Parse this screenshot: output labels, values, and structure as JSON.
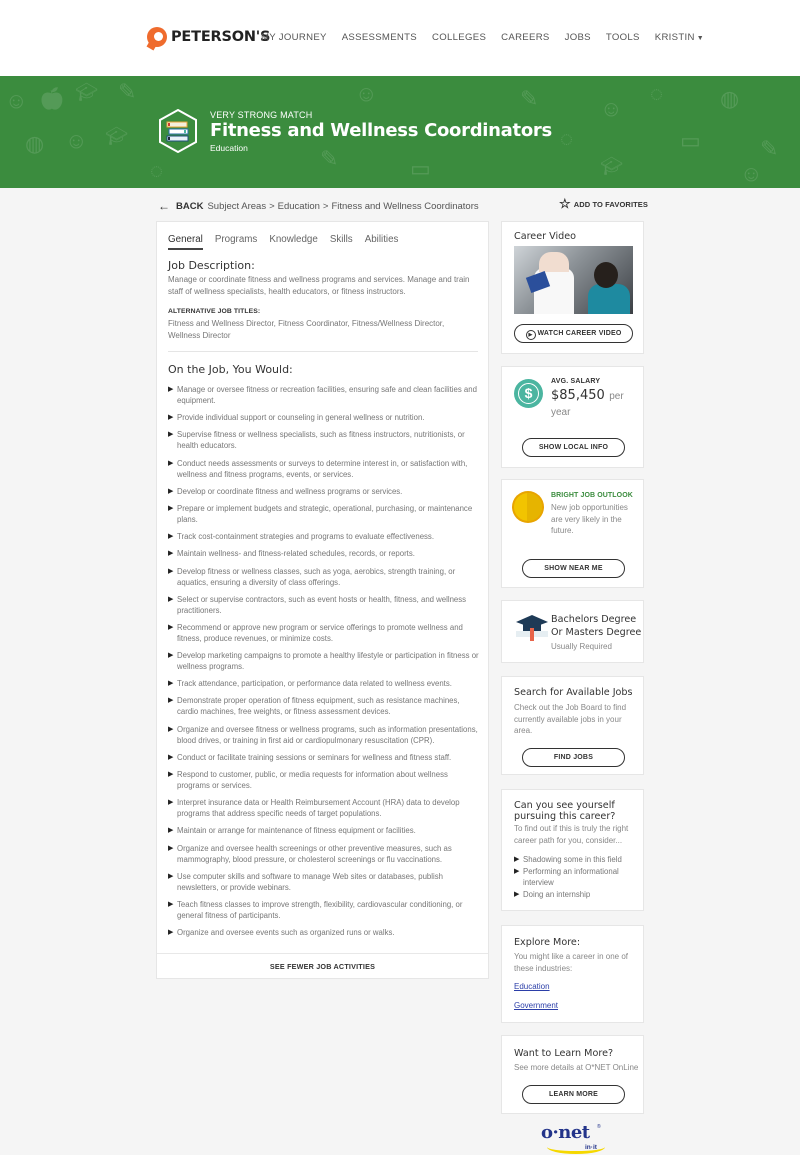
{
  "header": {
    "brand": "PETERSON'S",
    "nav": [
      "MY JOURNEY",
      "ASSESSMENTS",
      "COLLEGES",
      "CAREERS",
      "JOBS",
      "TOOLS"
    ],
    "user_menu": "KRISTIN"
  },
  "banner": {
    "match_label": "VERY STRONG MATCH",
    "title": "Fitness and Wellness Coordinators",
    "area": "Education",
    "background_color": "#3b8c3e"
  },
  "breadcrumb": {
    "back_label": "BACK",
    "items": [
      "Subject Areas",
      "Education",
      "Fitness and Wellness Coordinators"
    ],
    "separator": ">",
    "favorites_label": "ADD TO FAVORITES"
  },
  "main": {
    "tabs": [
      {
        "label": "General",
        "active": true
      },
      {
        "label": "Programs",
        "active": false
      },
      {
        "label": "Knowledge",
        "active": false
      },
      {
        "label": "Skills",
        "active": false
      },
      {
        "label": "Abilities",
        "active": false
      }
    ],
    "job_description_title": "Job Description:",
    "job_description": "Manage or coordinate fitness and wellness programs and services. Manage and train staff of wellness specialists, health educators, or fitness instructors.",
    "alt_titles_label": "ALTERNATIVE JOB TITLES:",
    "alt_titles": "Fitness and Wellness Director, Fitness Coordinator, Fitness/Wellness Director, Wellness Director",
    "on_the_job_title": "On the Job, You Would:",
    "activities": [
      "Manage or oversee fitness or recreation facilities, ensuring safe and clean facilities and equipment.",
      "Provide individual support or counseling in general wellness or nutrition.",
      "Supervise fitness or wellness specialists, such as fitness instructors, nutritionists, or health educators.",
      "Conduct needs assessments or surveys to determine interest in, or satisfaction with, wellness and fitness programs, events, or services.",
      "Develop or coordinate fitness and wellness programs or services.",
      "Prepare or implement budgets and strategic, operational, purchasing, or maintenance plans.",
      "Track cost-containment strategies and programs to evaluate effectiveness.",
      "Maintain wellness- and fitness-related schedules, records, or reports.",
      "Develop fitness or wellness classes, such as yoga, aerobics, strength training, or aquatics, ensuring a diversity of class offerings.",
      "Select or supervise contractors, such as event hosts or health, fitness, and wellness practitioners.",
      "Recommend or approve new program or service offerings to promote wellness and fitness, produce revenues, or minimize costs.",
      "Develop marketing campaigns to promote a healthy lifestyle or participation in fitness or wellness programs.",
      "Track attendance, participation, or performance data related to wellness events.",
      "Demonstrate proper operation of fitness equipment, such as resistance machines, cardio machines, free weights, or fitness assessment devices.",
      "Organize and oversee fitness or wellness programs, such as information presentations, blood drives, or training in first aid or cardiopulmonary resuscitation (CPR).",
      "Conduct or facilitate training sessions or seminars for wellness and fitness staff.",
      "Respond to customer, public, or media requests for information about wellness programs or services.",
      "Interpret insurance data or Health Reimbursement Account (HRA) data to develop programs that address specific needs of target populations.",
      "Maintain or arrange for maintenance of fitness equipment or facilities.",
      "Organize and oversee health screenings or other preventive measures, such as mammography, blood pressure, or cholesterol screenings or flu vaccinations.",
      "Use computer skills and software to manage Web sites or databases, publish newsletters, or provide webinars.",
      "Teach fitness classes to improve strength, flexibility, cardiovascular conditioning, or general fitness of participants.",
      "Organize and oversee events such as organized runs or walks."
    ],
    "see_fewer_label": "SEE FEWER JOB ACTIVITIES"
  },
  "sidebar": {
    "video": {
      "title": "Career Video",
      "button": "WATCH CAREER VIDEO"
    },
    "salary": {
      "label": "AVG. SALARY",
      "amount": "$85,450",
      "unit_1": "per",
      "unit_2": "year",
      "button": "SHOW LOCAL INFO"
    },
    "outlook": {
      "label": "BRIGHT JOB OUTLOOK",
      "text": "New job opportunities are very likely in the future.",
      "button": "SHOW NEAR ME",
      "label_color": "#3b8c3e"
    },
    "education": {
      "degree_line1": "Bachelors Degree",
      "degree_line2": "Or Masters Degree",
      "note": "Usually Required"
    },
    "jobs": {
      "title": "Search for Available Jobs",
      "text": "Check out the Job Board to find currently available jobs in your area.",
      "button": "FIND JOBS"
    },
    "pursue": {
      "title": "Can you see yourself pursuing this career?",
      "text": "To find out if this is truly the right career path for you, consider...",
      "items": [
        "Shadowing some in this field",
        "Performing an informational interview",
        "Doing an internship"
      ]
    },
    "explore": {
      "title": "Explore More:",
      "text": "You might like a career in one of these industries:",
      "links": [
        "Education",
        "Government"
      ]
    },
    "learn": {
      "title": "Want to Learn More?",
      "text": "See more details at O*NET OnLine",
      "button": "LEARN MORE"
    }
  },
  "footer_logo": {
    "main": "o·net",
    "tag": "in·it"
  }
}
